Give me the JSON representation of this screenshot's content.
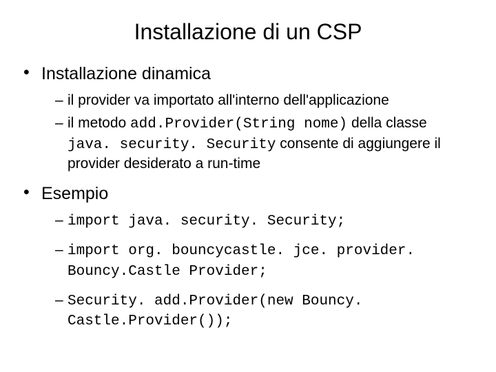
{
  "title": "Installazione di un CSP",
  "sections": [
    {
      "heading": "Installazione dinamica",
      "items": [
        {
          "runs": [
            {
              "t": "il provider va importato all'interno dell'applicazione",
              "code": false
            }
          ]
        },
        {
          "runs": [
            {
              "t": "il metodo ",
              "code": false
            },
            {
              "t": "add.Provider(String nome)",
              "code": true
            },
            {
              "t": " della classe ",
              "code": false
            },
            {
              "t": "java. security. Security",
              "code": true
            },
            {
              "t": " consente di aggiungere il provider desiderato a run-time",
              "code": false
            }
          ]
        }
      ]
    },
    {
      "heading": "Esempio",
      "items": [
        {
          "runs": [
            {
              "t": "import java. security. Security;",
              "code": true
            }
          ]
        },
        {
          "runs": [
            {
              "t": "import org. bouncycastle. jce. provider. Bouncy.Castle Provider;",
              "code": true
            }
          ]
        },
        {
          "runs": [
            {
              "t": "Security. add.Provider(new Bouncy. Castle.Provider());",
              "code": true
            }
          ]
        }
      ]
    }
  ]
}
